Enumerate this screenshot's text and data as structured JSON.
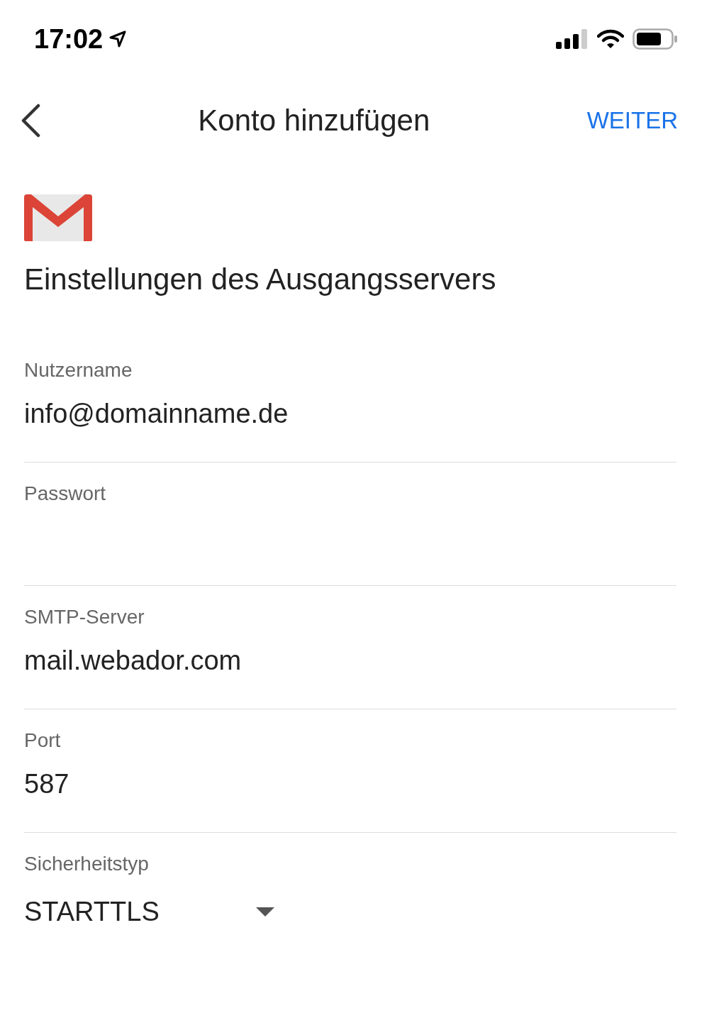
{
  "status_bar": {
    "time": "17:02"
  },
  "header": {
    "title": "Konto hinzufügen",
    "action": "WEITER"
  },
  "heading": "Einstellungen des Ausgangsservers",
  "fields": [
    {
      "kind": "text",
      "label": "Nutzername",
      "value": "info@domainname.de"
    },
    {
      "kind": "password",
      "label": "Passwort"
    },
    {
      "kind": "text",
      "label": "SMTP-Server",
      "value": "mail.webador.com"
    },
    {
      "kind": "text",
      "label": "Port",
      "value": "587"
    },
    {
      "kind": "dropdown",
      "label": "Sicherheitstyp",
      "value": "STARTTLS"
    }
  ]
}
